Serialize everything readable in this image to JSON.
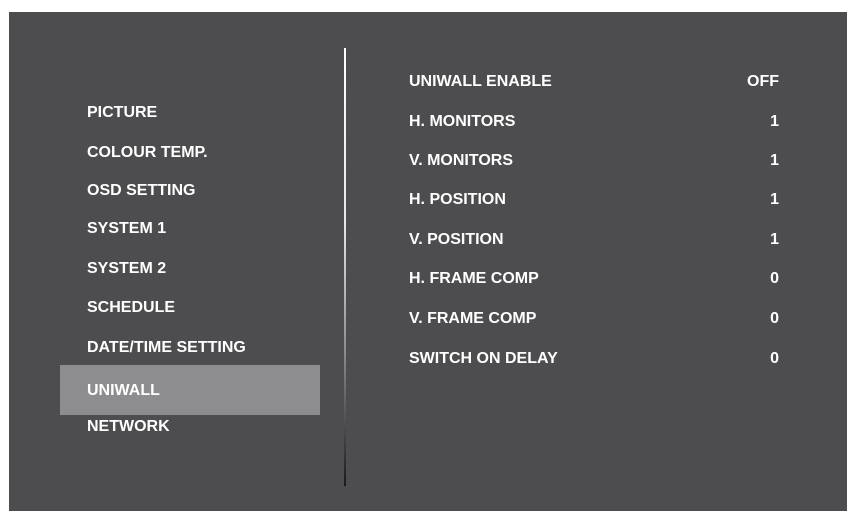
{
  "menu": {
    "items": [
      {
        "label": "PICTURE"
      },
      {
        "label": "COLOUR TEMP."
      },
      {
        "label": "OSD SETTING"
      },
      {
        "label": "SYSTEM 1"
      },
      {
        "label": "SYSTEM 2"
      },
      {
        "label": "SCHEDULE"
      },
      {
        "label": "DATE/TIME SETTING"
      },
      {
        "label": "UNIWALL"
      },
      {
        "label": "NETWORK"
      }
    ],
    "selected_label": "UNIWALL"
  },
  "settings": [
    {
      "label": "UNIWALL ENABLE",
      "value": "OFF"
    },
    {
      "label": "H. MONITORS",
      "value": "1"
    },
    {
      "label": "V. MONITORS",
      "value": "1"
    },
    {
      "label": "H. POSITION",
      "value": "1"
    },
    {
      "label": "V. POSITION",
      "value": "1"
    },
    {
      "label": "H. FRAME COMP",
      "value": "0"
    },
    {
      "label": "V. FRAME COMP",
      "value": "0"
    },
    {
      "label": "SWITCH ON DELAY",
      "value": "0"
    }
  ],
  "colors": {
    "background": "#4d4d4f",
    "selected_highlight": "#8d8d8f",
    "text": "#ffffff"
  }
}
